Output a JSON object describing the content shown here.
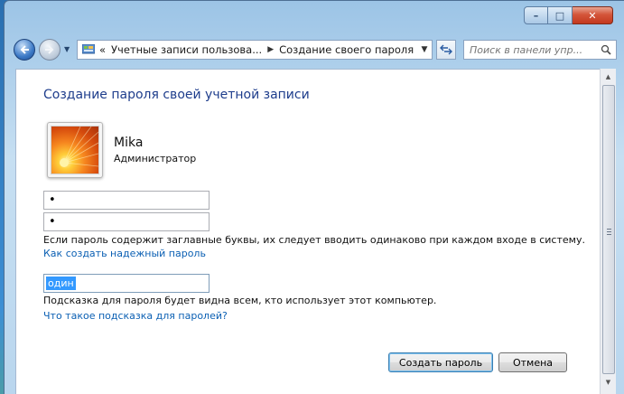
{
  "window": {
    "title_buttons": {
      "minimize": "–",
      "maximize": "□",
      "close": "✕"
    }
  },
  "navbar": {
    "back_icon": "back-arrow-icon",
    "forward_icon": "forward-arrow-icon",
    "address_prefix": "«",
    "breadcrumb_1": "Учетные записи пользова...",
    "breadcrumb_sep": "▶",
    "breadcrumb_2": "Создание своего пароля",
    "search_placeholder": "Поиск в панели упр..."
  },
  "main": {
    "title": "Создание пароля своей учетной записи",
    "user": {
      "name": "Mika",
      "role": "Администратор"
    },
    "new_password_value": "•",
    "confirm_password_value": "•",
    "case_note": "Если пароль содержит заглавные буквы, их следует вводить одинаково при каждом входе в систему.",
    "strong_password_link": "Как создать надежный пароль",
    "hint_value": "один",
    "hint_note": "Подсказка для пароля будет видна всем, кто использует этот компьютер.",
    "hint_help_link": "Что такое подсказка для паролей?",
    "create_button": "Создать пароль",
    "cancel_button": "Отмена"
  },
  "colors": {
    "title_blue": "#1e3d8c",
    "link_blue": "#0a5fb3",
    "selection": "#3399ff"
  }
}
